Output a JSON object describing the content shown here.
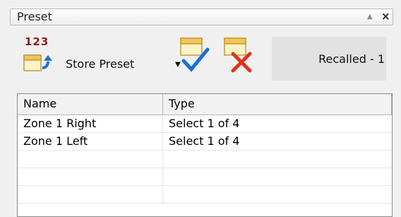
{
  "panel": {
    "title": "Preset"
  },
  "toolbar": {
    "store_number": "123",
    "store_label": "Store Preset",
    "recalled_label": "Recalled - 1"
  },
  "table": {
    "columns": [
      "Name",
      "Type"
    ],
    "rows": [
      {
        "name": "Zone 1 Right",
        "type": "Select 1 of 4"
      },
      {
        "name": "Zone 1 Left",
        "type": "Select 1 of 4"
      },
      {
        "name": "",
        "type": ""
      },
      {
        "name": "",
        "type": ""
      },
      {
        "name": "",
        "type": ""
      }
    ]
  },
  "colors": {
    "accent_blue": "#1a6fd6",
    "delete_red": "#e0331c",
    "store_number": "#8a1f1f"
  }
}
